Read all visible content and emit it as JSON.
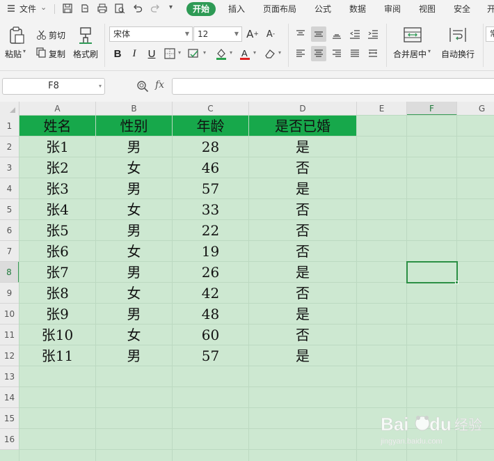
{
  "menubar": {
    "file": "文件",
    "tabs": [
      "开始",
      "插入",
      "页面布局",
      "公式",
      "数据",
      "审阅",
      "视图",
      "安全",
      "开"
    ]
  },
  "ribbon": {
    "paste": "粘贴",
    "cut": "剪切",
    "copy": "复制",
    "format_painter": "格式刷",
    "font_name": "宋体",
    "font_size": "12",
    "merge_center": "合并居中",
    "wrap_text": "自动换行",
    "cut_off": "常"
  },
  "formula_bar": {
    "name_box": "F8",
    "fx": "fx",
    "formula": ""
  },
  "sheet": {
    "columns": [
      "A",
      "B",
      "C",
      "D",
      "E",
      "F",
      "G"
    ],
    "rows": [
      "1",
      "2",
      "3",
      "4",
      "5",
      "6",
      "7",
      "8",
      "9",
      "10",
      "11",
      "12",
      "13",
      "14",
      "15",
      "16"
    ],
    "selected_cell": "F8",
    "header": [
      "姓名",
      "性别",
      "年龄",
      "是否已婚"
    ],
    "data": [
      [
        "张1",
        "男",
        "28",
        "是"
      ],
      [
        "张2",
        "女",
        "46",
        "否"
      ],
      [
        "张3",
        "男",
        "57",
        "是"
      ],
      [
        "张4",
        "女",
        "33",
        "否"
      ],
      [
        "张5",
        "男",
        "22",
        "否"
      ],
      [
        "张6",
        "女",
        "19",
        "否"
      ],
      [
        "张7",
        "男",
        "26",
        "是"
      ],
      [
        "张8",
        "女",
        "42",
        "否"
      ],
      [
        "张9",
        "男",
        "48",
        "是"
      ],
      [
        "张10",
        "女",
        "60",
        "否"
      ],
      [
        "张11",
        "男",
        "57",
        "是"
      ]
    ]
  },
  "colors": {
    "accent": "#2e9a55",
    "header_fill": "#17a84b",
    "sheet_bg": "#cde8d1"
  }
}
